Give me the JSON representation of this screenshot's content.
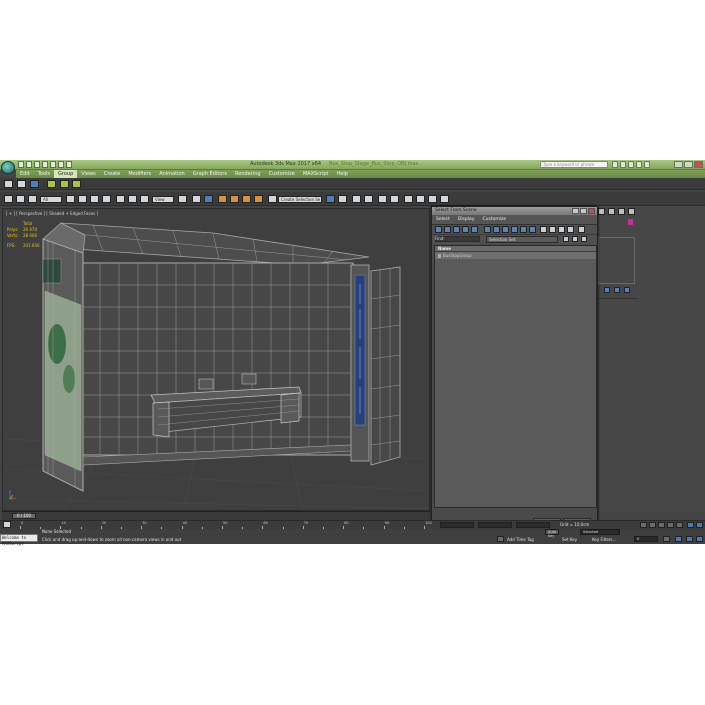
{
  "app": {
    "title": "Autodesk 3ds Max 2017 x64",
    "filename": "Bus_Stop_Stage_Bus_Stop_OBJ.max",
    "search_placeholder": "Type a keyword or phrase"
  },
  "menu": [
    "Edit",
    "Tools",
    "Group",
    "Views",
    "Create",
    "Modifiers",
    "Animation",
    "Graph Editors",
    "Rendering",
    "Customize",
    "MAXScript",
    "Help"
  ],
  "toolbar": {
    "selection_filter": "All",
    "ref_coord": "View",
    "named_selection": "Create Selection Se"
  },
  "viewport": {
    "label": "[ + ] [ Perspective ] [ Shaded + Edged Faces ]",
    "stats_header": "Total",
    "polys_label": "Polys:",
    "polys_value": "26 470",
    "verts_label": "Verts:",
    "verts_value": "28 006",
    "fps_label": "FPS:",
    "fps_value": "201.656"
  },
  "dialog": {
    "title": "Select From Scene",
    "menu": [
      "Select",
      "Display",
      "Customize"
    ],
    "find_label": "Find:",
    "selection_set": "Selection Set:",
    "column_name": "Name",
    "rows": [
      "BusStopGroup"
    ],
    "ok": "OK",
    "cancel": "Cancel"
  },
  "timeline": {
    "frame_thumb": "0 / 100",
    "ticks": [
      "0",
      "10",
      "20",
      "30",
      "40",
      "50",
      "60",
      "70",
      "80",
      "90",
      "100"
    ]
  },
  "status": {
    "welcome": "Welcome to MAXScript",
    "selected": "None Selected",
    "prompt": "Click and drag up-and-down to zoom all non-camera views in and out",
    "grid": "Grid = 10,0cm",
    "add_time_tag": "Add Time Tag",
    "auto_key": "Auto Key",
    "set_key": "Set Key",
    "selected_dd": "Selected",
    "key_filters": "Key Filters...",
    "frame": "0"
  }
}
